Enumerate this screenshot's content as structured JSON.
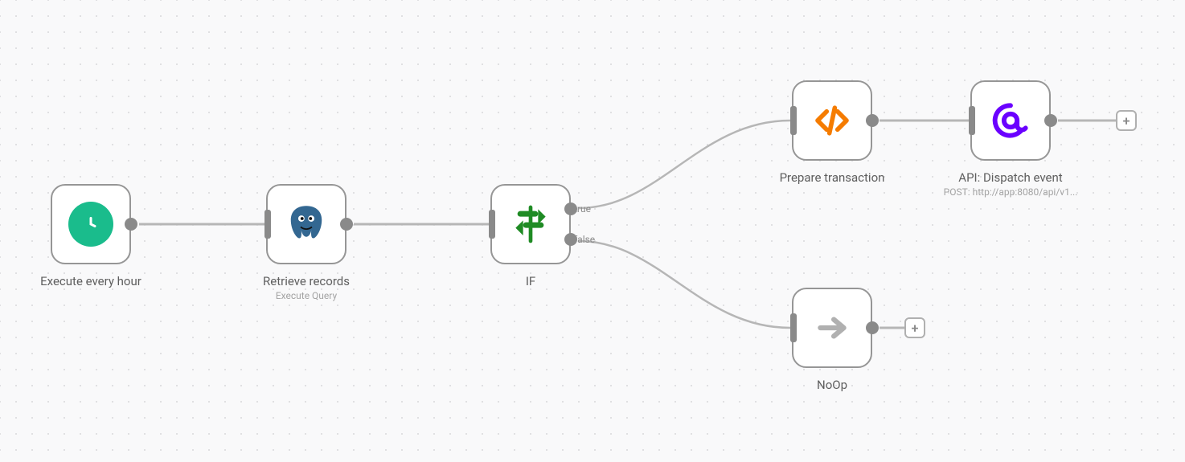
{
  "nodes": {
    "trigger": {
      "title": "Execute every hour"
    },
    "retrieve": {
      "title": "Retrieve records",
      "sub": "Execute Query"
    },
    "if": {
      "title": "IF",
      "true_label": "true",
      "false_label": "false"
    },
    "prepare": {
      "title": "Prepare transaction"
    },
    "api": {
      "title": "API: Dispatch event",
      "sub": "POST: http://app:8080/api/v1..."
    },
    "noop": {
      "title": "NoOp"
    }
  },
  "add_button": "+"
}
